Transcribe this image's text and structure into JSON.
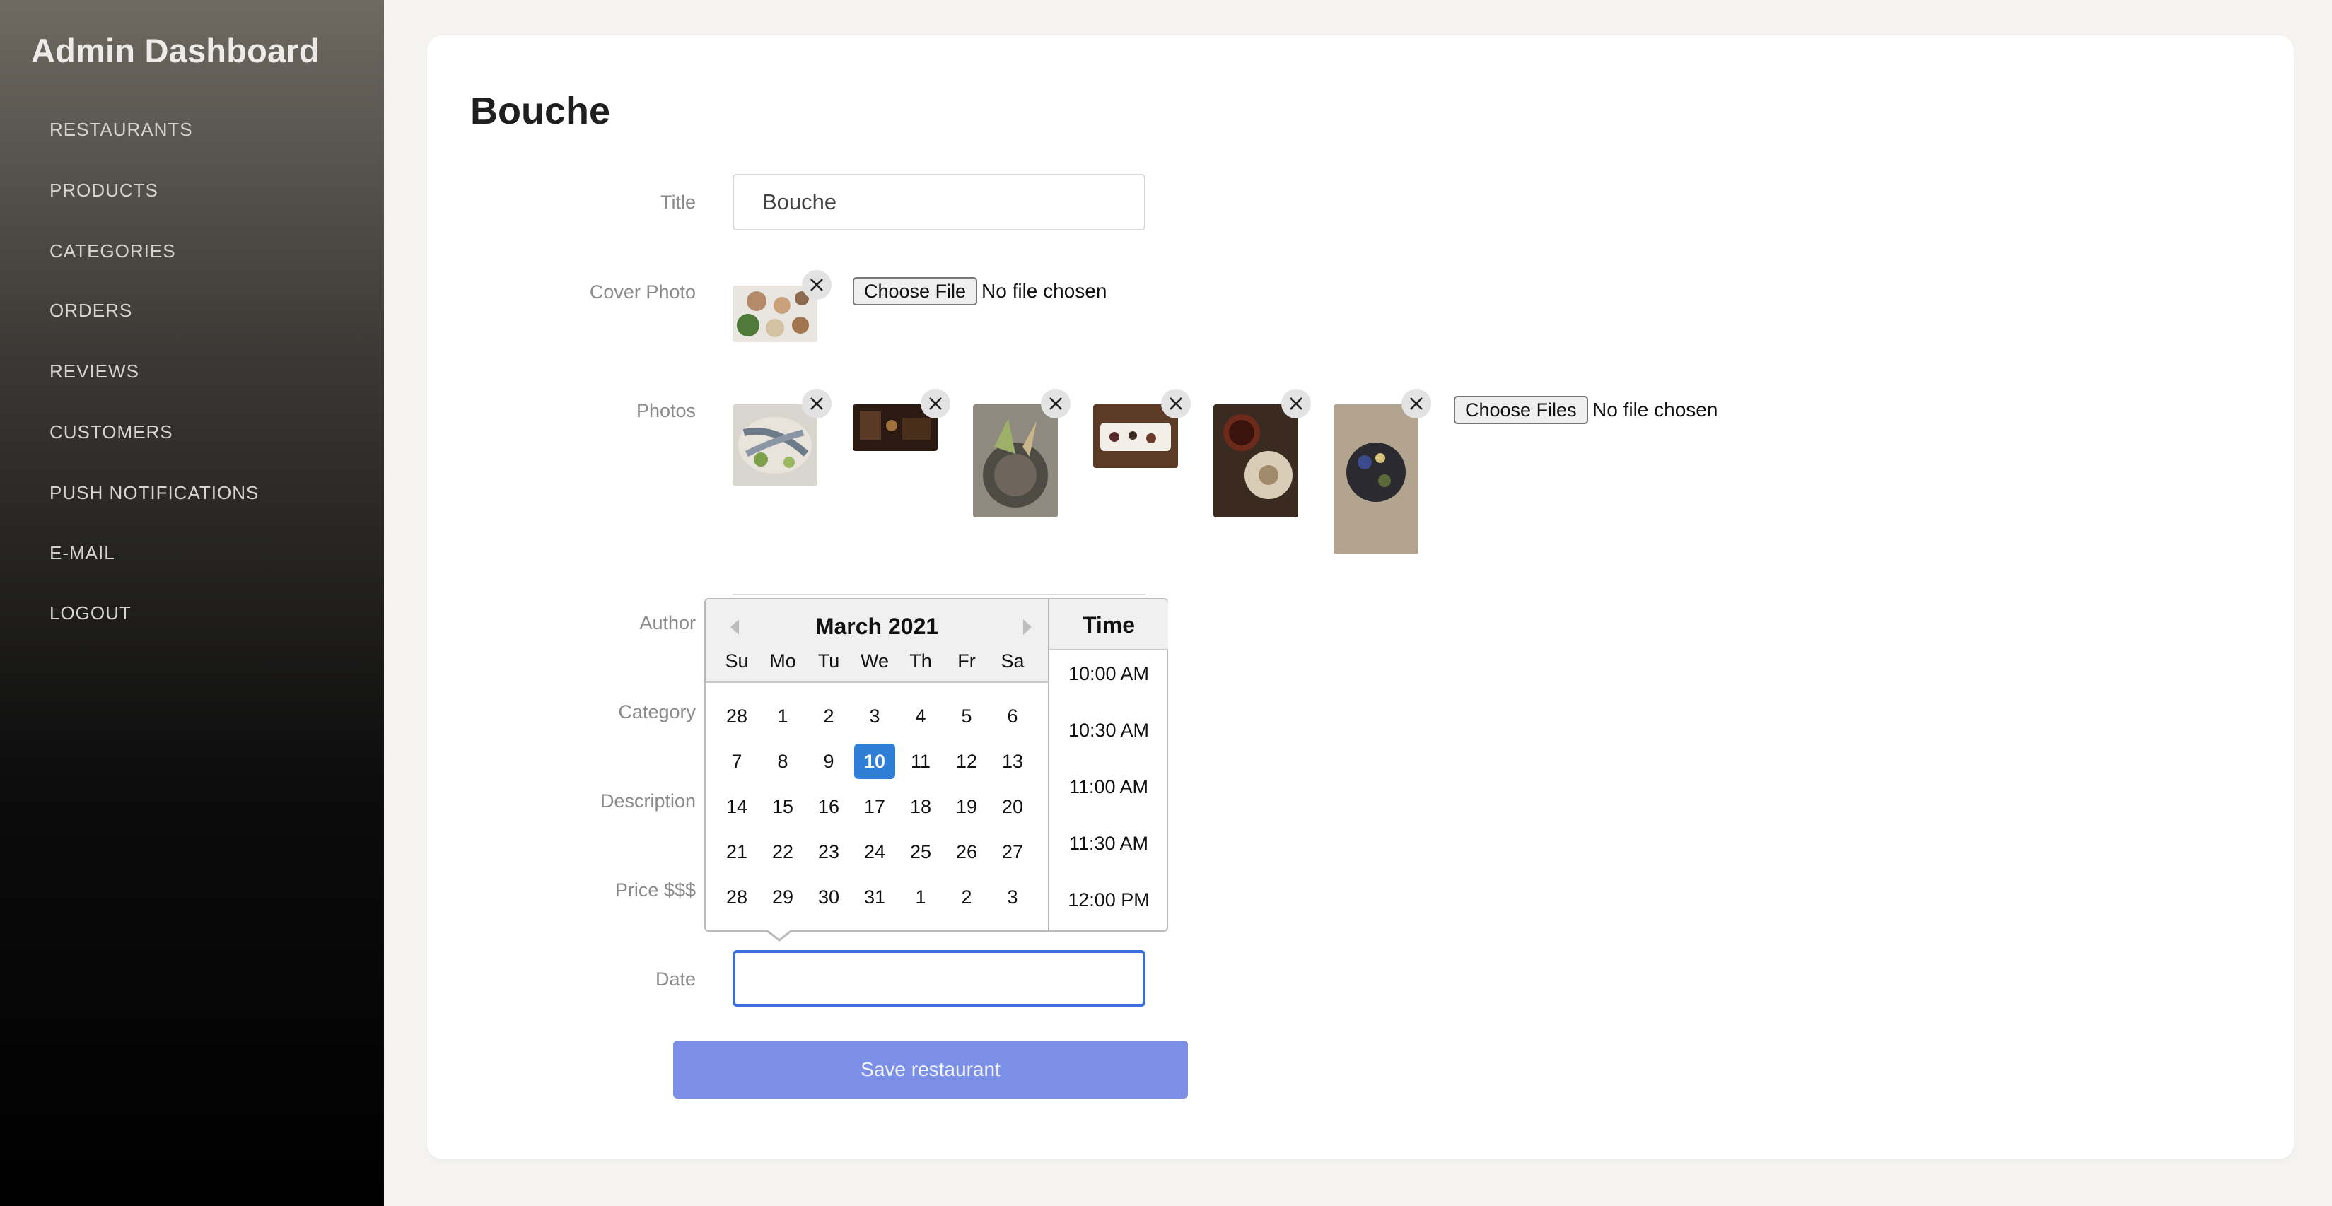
{
  "app": {
    "title": "Admin Dashboard"
  },
  "sidebar": {
    "items": [
      {
        "label": "RESTAURANTS"
      },
      {
        "label": "PRODUCTS"
      },
      {
        "label": "CATEGORIES"
      },
      {
        "label": "ORDERS"
      },
      {
        "label": "REVIEWS"
      },
      {
        "label": "CUSTOMERS"
      },
      {
        "label": "PUSH NOTIFICATIONS"
      },
      {
        "label": "E-MAIL"
      },
      {
        "label": "LOGOUT"
      }
    ]
  },
  "form": {
    "page_title": "Bouche",
    "labels": {
      "title": "Title",
      "cover_photo": "Cover Photo",
      "photos": "Photos",
      "author": "Author",
      "category": "Category",
      "description": "Description",
      "price": "Price $$$",
      "date": "Date"
    },
    "title_value": "Bouche",
    "cover_file_button": "Choose File",
    "cover_file_status": "No file chosen",
    "photos_file_button": "Choose Files",
    "photos_file_status": "No file chosen",
    "date_value": "",
    "save_button": "Save restaurant"
  },
  "datepicker": {
    "month_label": "March 2021",
    "time_header": "Time",
    "weekdays": [
      "Su",
      "Mo",
      "Tu",
      "We",
      "Th",
      "Fr",
      "Sa"
    ],
    "weeks": [
      [
        "28",
        "1",
        "2",
        "3",
        "4",
        "5",
        "6"
      ],
      [
        "7",
        "8",
        "9",
        "10",
        "11",
        "12",
        "13"
      ],
      [
        "14",
        "15",
        "16",
        "17",
        "18",
        "19",
        "20"
      ],
      [
        "21",
        "22",
        "23",
        "24",
        "25",
        "26",
        "27"
      ],
      [
        "28",
        "29",
        "30",
        "31",
        "1",
        "2",
        "3"
      ]
    ],
    "selected_day": "10",
    "times": [
      "10:00 AM",
      "10:30 AM",
      "11:00 AM",
      "11:30 AM",
      "12:00 PM"
    ]
  },
  "icons": {
    "remove": "close-icon",
    "prev": "arrow-left-icon",
    "next": "arrow-right-icon"
  },
  "colors": {
    "accent": "#3c6fd8",
    "selected_day": "#2f7ed6",
    "save_button": "#7b8fe6"
  }
}
